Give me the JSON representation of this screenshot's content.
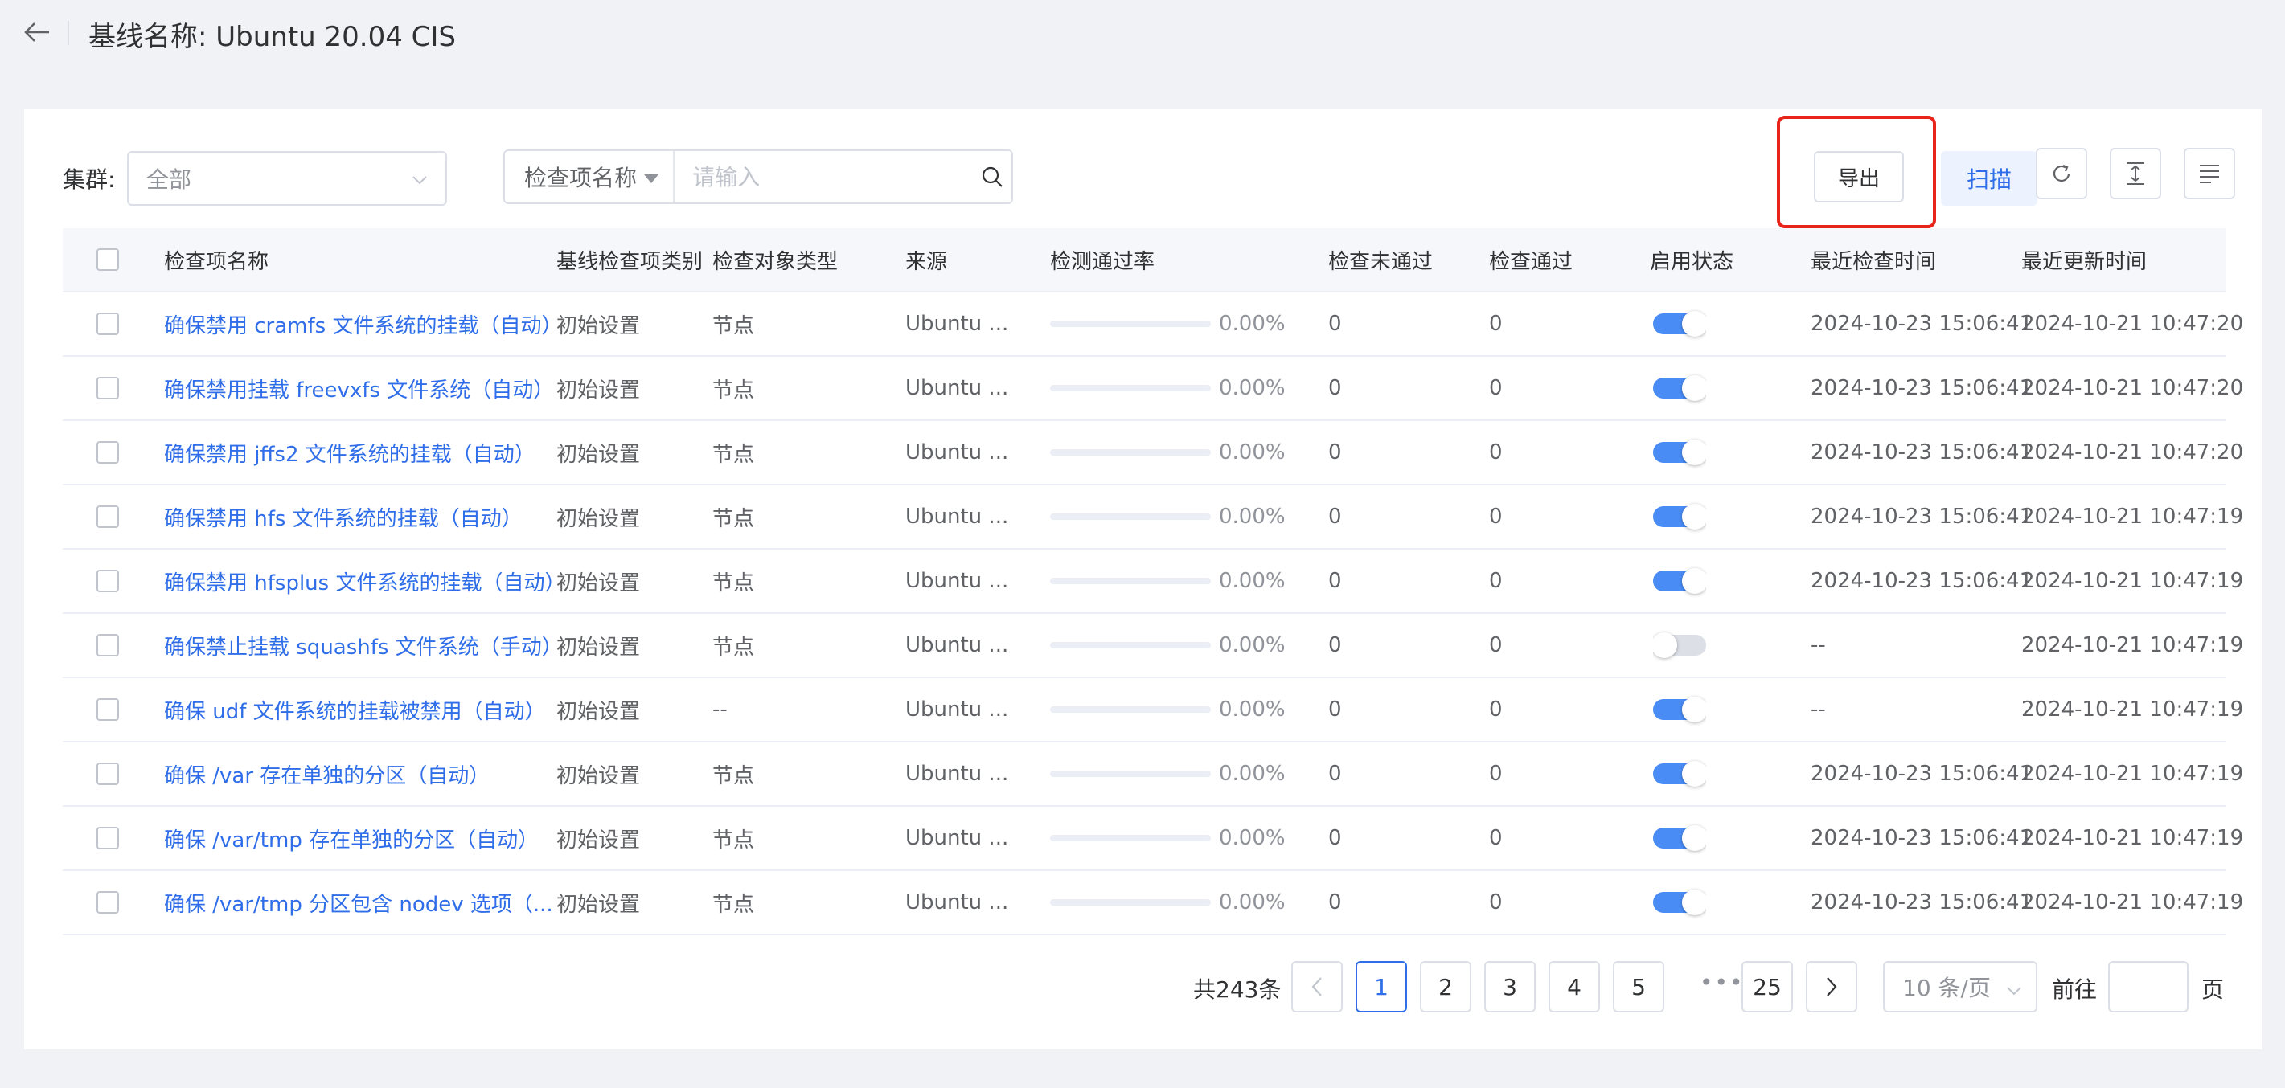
{
  "header": {
    "title": "基线名称: Ubuntu 20.04 CIS"
  },
  "filters": {
    "cluster_label": "集群:",
    "cluster_value": "全部",
    "search_field": "检查项名称",
    "search_placeholder": "请输入"
  },
  "toolbar": {
    "export_label": "导出",
    "scan_label": "扫描"
  },
  "table": {
    "columns": [
      "检查项名称",
      "基线检查项类别",
      "检查对象类型",
      "来源",
      "检测通过率",
      "检查未通过",
      "检查通过",
      "启用状态",
      "最近检查时间",
      "最近更新时间"
    ],
    "rows": [
      {
        "name": "确保禁用 cramfs 文件系统的挂载（自动）",
        "category": "初始设置",
        "object_type": "节点",
        "source": "Ubuntu ...",
        "pass_rate": 0,
        "pass_rate_text": "0.00%",
        "failed": "0",
        "passed": "0",
        "enabled": true,
        "last_check": "2024-10-23 15:06:41",
        "last_update": "2024-10-21 10:47:20"
      },
      {
        "name": "确保禁用挂载 freevxfs 文件系统（自动）",
        "category": "初始设置",
        "object_type": "节点",
        "source": "Ubuntu ...",
        "pass_rate": 0,
        "pass_rate_text": "0.00%",
        "failed": "0",
        "passed": "0",
        "enabled": true,
        "last_check": "2024-10-23 15:06:41",
        "last_update": "2024-10-21 10:47:20"
      },
      {
        "name": "确保禁用 jffs2 文件系统的挂载（自动）",
        "category": "初始设置",
        "object_type": "节点",
        "source": "Ubuntu ...",
        "pass_rate": 0,
        "pass_rate_text": "0.00%",
        "failed": "0",
        "passed": "0",
        "enabled": true,
        "last_check": "2024-10-23 15:06:41",
        "last_update": "2024-10-21 10:47:20"
      },
      {
        "name": "确保禁用 hfs 文件系统的挂载（自动）",
        "category": "初始设置",
        "object_type": "节点",
        "source": "Ubuntu ...",
        "pass_rate": 0,
        "pass_rate_text": "0.00%",
        "failed": "0",
        "passed": "0",
        "enabled": true,
        "last_check": "2024-10-23 15:06:41",
        "last_update": "2024-10-21 10:47:19"
      },
      {
        "name": "确保禁用 hfsplus 文件系统的挂载（自动）",
        "category": "初始设置",
        "object_type": "节点",
        "source": "Ubuntu ...",
        "pass_rate": 0,
        "pass_rate_text": "0.00%",
        "failed": "0",
        "passed": "0",
        "enabled": true,
        "last_check": "2024-10-23 15:06:41",
        "last_update": "2024-10-21 10:47:19"
      },
      {
        "name": "确保禁止挂载 squashfs 文件系统（手动）",
        "category": "初始设置",
        "object_type": "节点",
        "source": "Ubuntu ...",
        "pass_rate": 0,
        "pass_rate_text": "0.00%",
        "failed": "0",
        "passed": "0",
        "enabled": false,
        "last_check": "--",
        "last_update": "2024-10-21 10:47:19"
      },
      {
        "name": "确保 udf 文件系统的挂载被禁用（自动）",
        "category": "初始设置",
        "object_type": "--",
        "source": "Ubuntu ...",
        "pass_rate": 0,
        "pass_rate_text": "0.00%",
        "failed": "0",
        "passed": "0",
        "enabled": true,
        "last_check": "--",
        "last_update": "2024-10-21 10:47:19"
      },
      {
        "name": "确保 /var 存在单独的分区（自动）",
        "category": "初始设置",
        "object_type": "节点",
        "source": "Ubuntu ...",
        "pass_rate": 0,
        "pass_rate_text": "0.00%",
        "failed": "0",
        "passed": "0",
        "enabled": true,
        "last_check": "2024-10-23 15:06:41",
        "last_update": "2024-10-21 10:47:19"
      },
      {
        "name": "确保 /var/tmp 存在单独的分区（自动）",
        "category": "初始设置",
        "object_type": "节点",
        "source": "Ubuntu ...",
        "pass_rate": 0,
        "pass_rate_text": "0.00%",
        "failed": "0",
        "passed": "0",
        "enabled": true,
        "last_check": "2024-10-23 15:06:41",
        "last_update": "2024-10-21 10:47:19"
      },
      {
        "name": "确保 /var/tmp 分区包含 nodev 选项（...",
        "category": "初始设置",
        "object_type": "节点",
        "source": "Ubuntu ...",
        "pass_rate": 0,
        "pass_rate_text": "0.00%",
        "failed": "0",
        "passed": "0",
        "enabled": true,
        "last_check": "2024-10-23 15:06:41",
        "last_update": "2024-10-21 10:47:19"
      }
    ]
  },
  "pagination": {
    "total_text": "共243条",
    "pages": [
      "1",
      "2",
      "3",
      "4",
      "5"
    ],
    "current": "1",
    "ellipsis": "•••",
    "last_page": "25",
    "page_size": "10 条/页",
    "goto_label": "前往",
    "goto_suffix": "页"
  },
  "colors": {
    "primary": "#2f6ee8",
    "highlight": "#e8241b",
    "switch_on": "#4a8cf5"
  }
}
